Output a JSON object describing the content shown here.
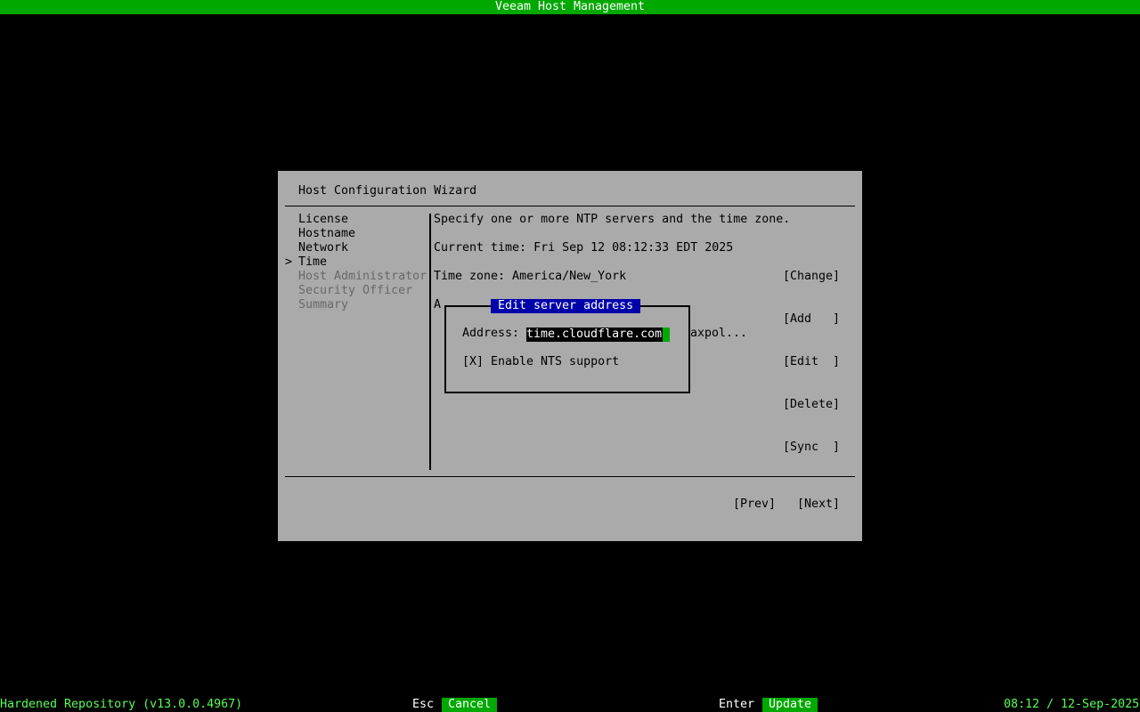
{
  "app_title": "Veeam Host Management",
  "wizard": {
    "title": "Host Configuration Wizard",
    "nav": [
      {
        "label": "License",
        "enabled": true
      },
      {
        "label": "Hostname",
        "enabled": true
      },
      {
        "label": "Network",
        "enabled": true
      },
      {
        "label": "Time",
        "enabled": true,
        "current": true
      },
      {
        "label": "Host Administrator",
        "enabled": false
      },
      {
        "label": "Security Officer",
        "enabled": false
      },
      {
        "label": "Summary",
        "enabled": false
      }
    ],
    "current_marker": ">",
    "intro": "Specify one or more NTP servers and the time zone.",
    "current_time": "Current time: Fri Sep 12 08:12:33 EDT 2025",
    "time_zone": "Time zone: America/New_York",
    "obscured_char": "A",
    "obscured_tail": "axpol...",
    "buttons": {
      "change": "[Change]",
      "add": "[Add   ]",
      "edit": "[Edit  ]",
      "delete": "[Delete]",
      "sync": "[Sync  ]",
      "prev": "[Prev]",
      "next": "[Next]"
    }
  },
  "dialog": {
    "title": "Edit server address",
    "address_label": "Address:",
    "address_value": "time.cloudflare.com",
    "nts_checkbox": "[X]",
    "nts_label": "Enable NTS support",
    "nts_checked": true
  },
  "statusbar": {
    "product": "Hardened Repository (v13.0.0.4967)",
    "esc_key": "Esc",
    "esc_action": "Cancel",
    "enter_key": "Enter",
    "enter_action": "Update",
    "clock": "08:12 / 12-Sep-2025"
  },
  "colors": {
    "accent_green": "#00a800",
    "status_text_green": "#55ff55",
    "dialog_title_blue": "#0000aa",
    "panel_gray": "#aaaaaa",
    "disabled_gray": "#686868"
  }
}
